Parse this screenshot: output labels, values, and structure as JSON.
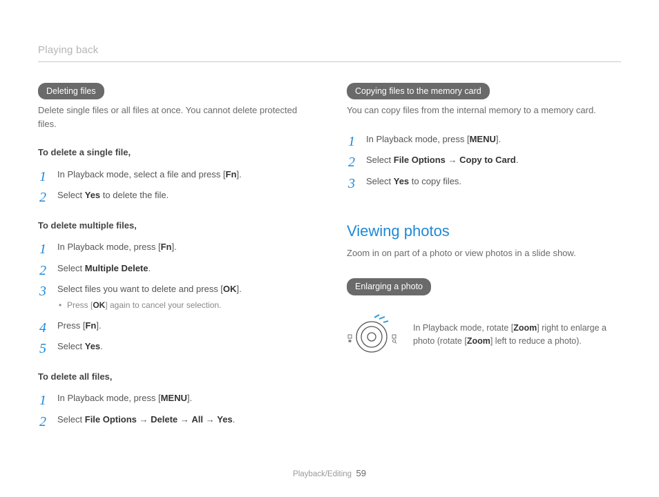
{
  "header": {
    "running": "Playing back"
  },
  "left": {
    "pill1": "Deleting files",
    "intro1": "Delete single files or all files at once. You cannot delete protected files.",
    "sub1": "To delete a single file,",
    "s1": {
      "a_pre": "In Playback mode, select a file and press [",
      "a_key": "Fn",
      "a_post": "].",
      "b_pre": "Select ",
      "b_bold": "Yes",
      "b_post": " to delete the file."
    },
    "sub2": "To delete multiple files,",
    "s2": {
      "a_pre": "In Playback mode, press [",
      "a_key": "Fn",
      "a_post": "].",
      "b_pre": "Select ",
      "b_bold": "Multiple Delete",
      "b_post": ".",
      "c_pre": "Select files you want to delete and press [",
      "c_key": "OK",
      "c_post": "].",
      "c_note_pre": "Press [",
      "c_note_key": "OK",
      "c_note_post": "] again to cancel your selection.",
      "d_pre": "Press [",
      "d_key": "Fn",
      "d_post": "].",
      "e_pre": "Select ",
      "e_bold": "Yes",
      "e_post": "."
    },
    "sub3": "To delete all files,",
    "s3": {
      "a_pre": "In Playback mode, press [",
      "a_key": "MENU",
      "a_post": "].",
      "b_pre": "Select ",
      "b_b1": "File Options",
      "b_arr1": " → ",
      "b_b2": "Delete",
      "b_arr2": " → ",
      "b_b3": "All",
      "b_arr3": " → ",
      "b_b4": "Yes",
      "b_post": "."
    }
  },
  "right": {
    "pill1": "Copying files to the memory card",
    "intro1": "You can copy files from the internal memory to a memory card.",
    "s1": {
      "a_pre": "In Playback mode, press [",
      "a_key": "MENU",
      "a_post": "].",
      "b_pre": "Select ",
      "b_b1": "File Options",
      "b_arr1": " → ",
      "b_b2": "Copy to Card",
      "b_post": ".",
      "c_pre": "Select ",
      "c_bold": "Yes",
      "c_post": " to copy files."
    },
    "h2": "Viewing photos",
    "intro2": "Zoom in on part of a photo or view photos in a slide show.",
    "pill2": "Enlarging a photo",
    "dial_pre": "In Playback mode, rotate [",
    "dial_key1": "Zoom",
    "dial_mid": "] right to enlarge a photo (rotate [",
    "dial_key2": "Zoom",
    "dial_post": "] left to reduce a photo)."
  },
  "footer": {
    "section": "Playback/Editing",
    "page": "59"
  }
}
